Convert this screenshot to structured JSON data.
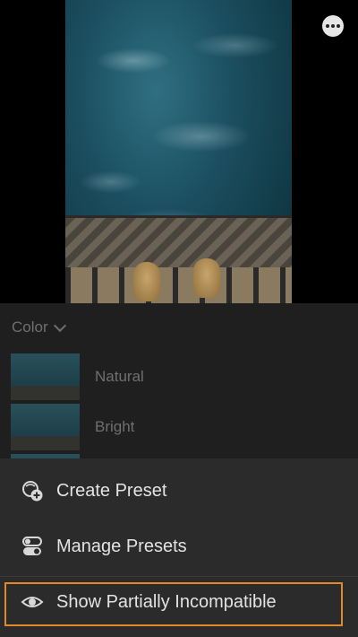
{
  "toolbar": {
    "more_icon": "ellipsis-icon"
  },
  "presets_panel": {
    "category_label": "Color",
    "category_icon": "chevron-down-icon",
    "presets": [
      {
        "label": "Natural"
      },
      {
        "label": "Bright"
      },
      {
        "label": ""
      }
    ]
  },
  "sheet": {
    "items": [
      {
        "label": "Create Preset",
        "icon": "create-preset-icon"
      },
      {
        "label": "Manage Presets",
        "icon": "toggles-icon"
      },
      {
        "label": "Show Partially Incompatible",
        "icon": "eye-icon"
      }
    ],
    "focus_color": "#e08a2a"
  }
}
